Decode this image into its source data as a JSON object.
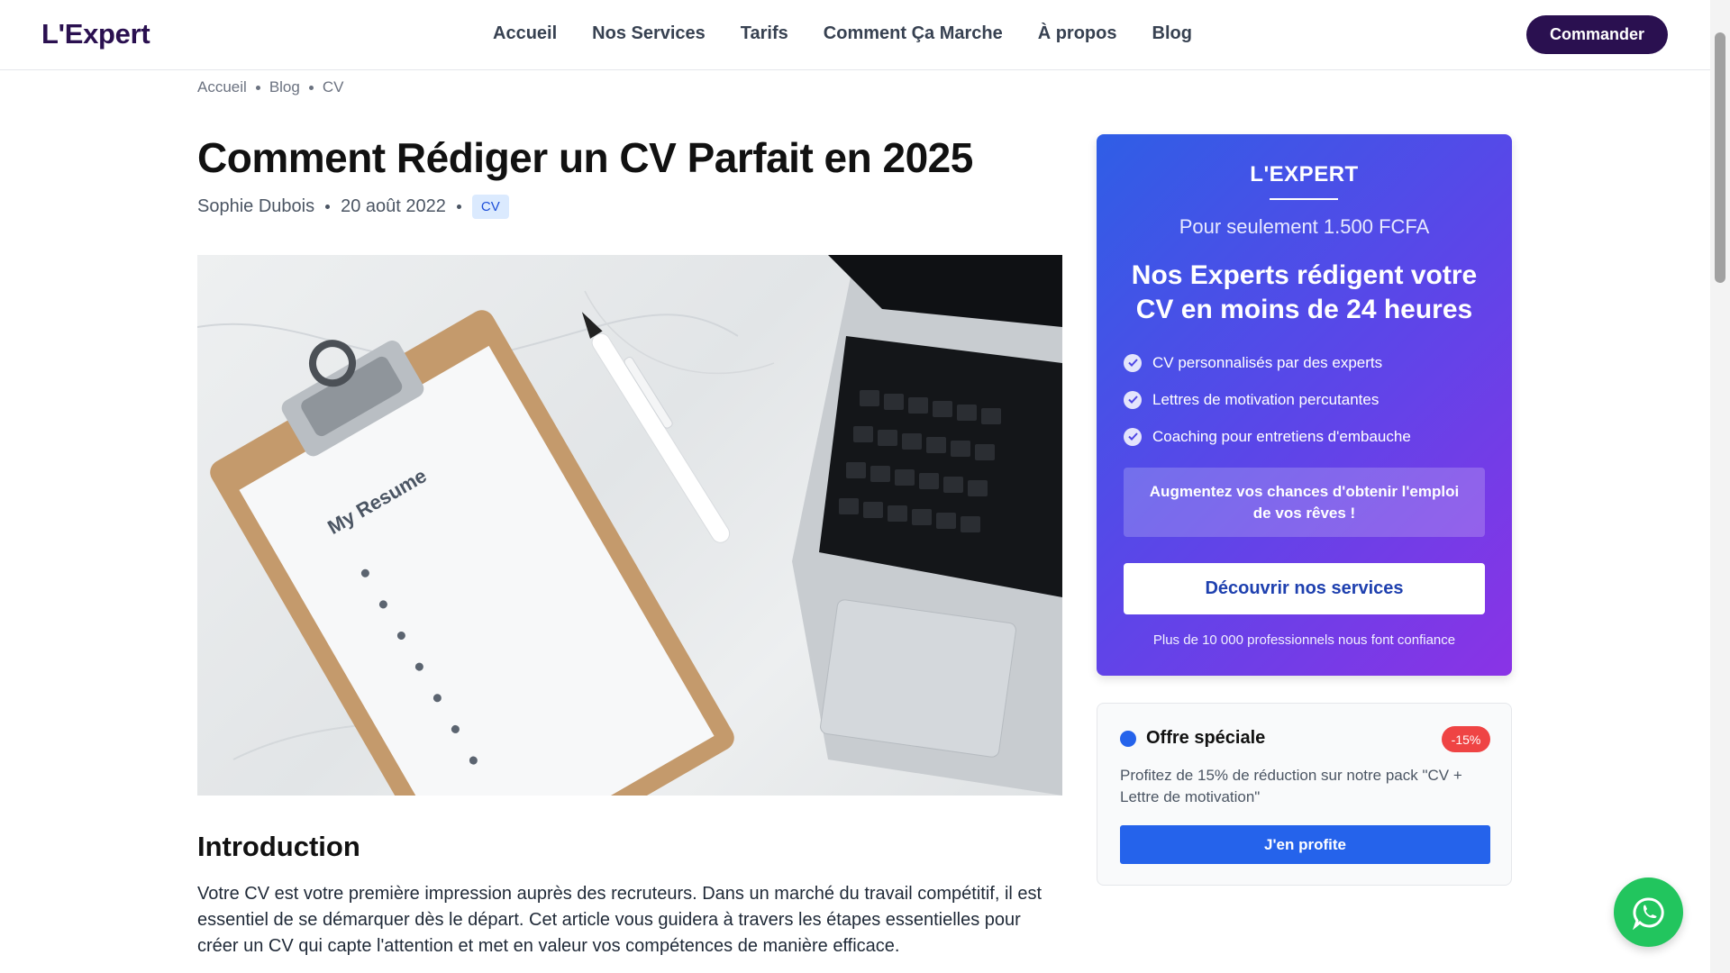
{
  "header": {
    "logo": "L'Expert",
    "nav": [
      "Accueil",
      "Nos Services",
      "Tarifs",
      "Comment Ça Marche",
      "À propos",
      "Blog"
    ],
    "order_label": "Commander"
  },
  "breadcrumb": [
    "Accueil",
    "Blog",
    "CV"
  ],
  "article": {
    "title": "Comment Rédiger un CV Parfait en 2025",
    "author": "Sophie Dubois",
    "date": "20 août 2022",
    "tag": "CV",
    "image_text": "My Resume",
    "intro_heading": "Introduction",
    "intro_text": "Votre CV est votre première impression auprès des recruteurs. Dans un marché du travail compétitif, il est essentiel de se démarquer dès le départ. Cet article vous guidera à travers les étapes essentielles pour créer un CV qui capte l'attention et met en valeur vos compétences de manière efficace."
  },
  "promo": {
    "brand": "L'EXPERT",
    "price": "Pour seulement 1.500 FCFA",
    "headline": "Nos Experts rédigent votre CV en moins de 24 heures",
    "features": [
      "CV personnalisés par des experts",
      "Lettres de motivation percutantes",
      "Coaching pour entretiens d'embauche"
    ],
    "callout": "Augmentez vos chances d'obtenir l'emploi de vos rêves !",
    "button": "Découvrir nos services",
    "trust": "Plus de 10 000 professionnels nous font confiance"
  },
  "offer": {
    "title": "Offre spéciale",
    "badge": "-15%",
    "text": "Profitez de 15% de réduction sur notre pack \"CV + Lettre de motivation\"",
    "button": "J'en profite"
  },
  "icons": {
    "check": "check-circle-icon",
    "whatsapp": "whatsapp-icon"
  },
  "colors": {
    "brand": "#2a1050",
    "accent": "#2563eb",
    "badge": "#ef4444",
    "whatsapp": "#22c55e"
  }
}
